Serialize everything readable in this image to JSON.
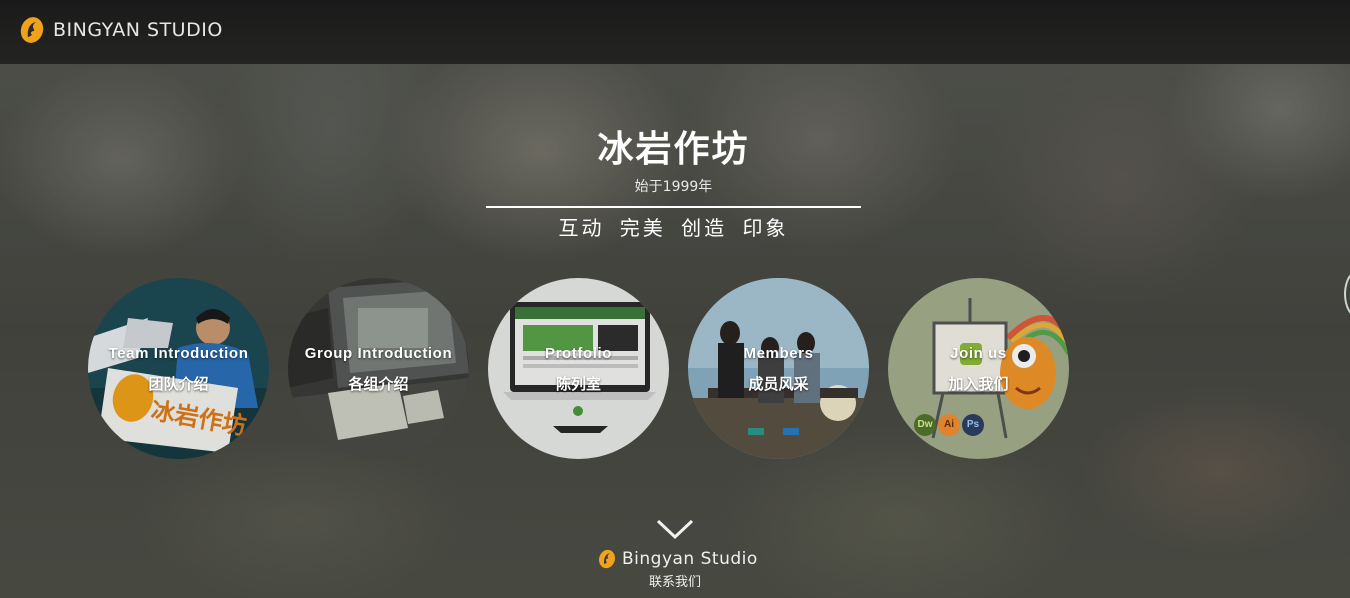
{
  "header": {
    "brand_name": "BINGYAN STUDIO",
    "logo_icon": "bingyan-logo-icon"
  },
  "hero": {
    "title": "冰岩作坊",
    "since": "始于1999年",
    "slogan": "互动  完美  创造  印象"
  },
  "sections": [
    {
      "label_en": "Team Introduction",
      "label_cn": "团队介绍"
    },
    {
      "label_en": "Group Introduction",
      "label_cn": "各组介绍"
    },
    {
      "label_en": "Protfolio",
      "label_cn": "陈列室"
    },
    {
      "label_en": "Members",
      "label_cn": "成员风采"
    },
    {
      "label_en": "Join us",
      "label_cn": "加入我们"
    }
  ],
  "join_badges": [
    "Dw",
    "Ai",
    "Ps"
  ],
  "team_card_text": "冰岩作坊",
  "footer": {
    "brand_name": "Bingyan Studio",
    "contact_label": "联系我们"
  },
  "colors": {
    "logo_orange": "#f0a21a",
    "topbar": "#1e1e1d"
  }
}
